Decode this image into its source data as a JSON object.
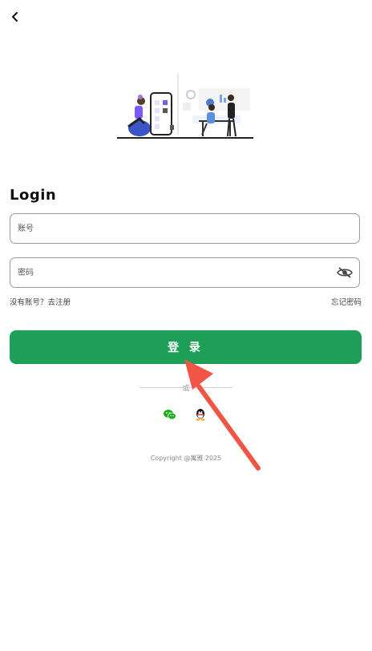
{
  "header": {
    "back_icon": "chevron-left-icon"
  },
  "illustration": {
    "name": "login-illustration"
  },
  "login": {
    "title": "Login",
    "account_placeholder": "账号",
    "password_placeholder": "密码",
    "password_toggle_icon": "eye-off-icon",
    "register_link": "没有账号？去注册",
    "forgot_link": "忘记密码",
    "submit_label": "登 录",
    "or_text": "或"
  },
  "social": {
    "items": [
      {
        "name": "wechat",
        "icon": "wechat-icon",
        "color": "#1aad19"
      },
      {
        "name": "qq",
        "icon": "qq-icon",
        "color": "#000000"
      }
    ]
  },
  "footer": {
    "copyright": "Copyright @寓雅 2025"
  },
  "colors": {
    "primary": "#1e9f57",
    "annotation_arrow": "#f05545"
  }
}
